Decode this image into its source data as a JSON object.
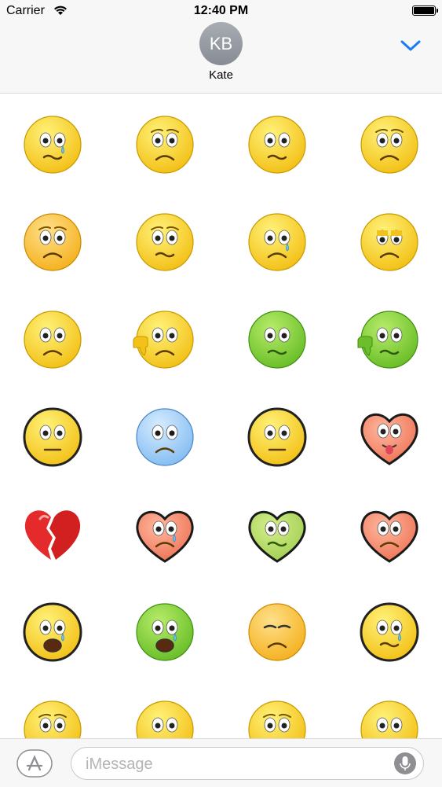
{
  "status_bar": {
    "carrier": "Carrier",
    "time": "12:40 PM"
  },
  "header": {
    "avatar_initials": "KB",
    "contact_name": "Kate"
  },
  "input_bar": {
    "placeholder": "iMessage"
  },
  "icons": {
    "wifi": "wifi-icon",
    "battery": "battery-icon",
    "collapse": "chevron-down-icon",
    "app_store": "app-store-icon",
    "microphone": "microphone-icon"
  },
  "colors": {
    "accent": "#1a7cf5",
    "bar_bg": "#f7f7f7",
    "avatar": "#9a9ea5"
  },
  "stickers": [
    {
      "name": "crying-face",
      "face": "yellow",
      "mouth": "wavy",
      "extra": "tear"
    },
    {
      "name": "worried-face",
      "face": "yellow",
      "mouth": "frown",
      "extra": "brows"
    },
    {
      "name": "confused-face",
      "face": "yellow",
      "mouth": "wavy",
      "extra": ""
    },
    {
      "name": "pleading-face",
      "face": "yellow",
      "mouth": "frown",
      "extra": "brows"
    },
    {
      "name": "sad-stare-face",
      "face": "orange",
      "mouth": "frown",
      "extra": "brows"
    },
    {
      "name": "anxious-face",
      "face": "yellow",
      "mouth": "wavy",
      "extra": "brows"
    },
    {
      "name": "tearful-face",
      "face": "yellow",
      "mouth": "frown",
      "extra": "tear"
    },
    {
      "name": "tired-face",
      "face": "yellow",
      "mouth": "frown",
      "extra": "droopy"
    },
    {
      "name": "frowning-face",
      "face": "yellow",
      "mouth": "frown",
      "extra": ""
    },
    {
      "name": "thumbs-down-yellow-face",
      "face": "yellow",
      "mouth": "frown",
      "extra": "thumbsdown"
    },
    {
      "name": "sick-green-face",
      "face": "green",
      "mouth": "wavy",
      "extra": ""
    },
    {
      "name": "thumbs-down-green-face",
      "face": "green",
      "mouth": "wavy",
      "extra": "thumbsdown"
    },
    {
      "name": "bulging-eyes-face",
      "face": "yellow",
      "mouth": "flat",
      "extra": ""
    },
    {
      "name": "blue-sad-face",
      "face": "blue",
      "mouth": "frown",
      "extra": ""
    },
    {
      "name": "eye-roll-face",
      "face": "yellow",
      "mouth": "flat",
      "extra": ""
    },
    {
      "name": "heart-tongue-face",
      "face": "heart-red",
      "mouth": "tongue",
      "extra": ""
    },
    {
      "name": "broken-heart",
      "face": "broken-heart",
      "mouth": "none",
      "extra": ""
    },
    {
      "name": "heart-crying-face",
      "face": "heart-red",
      "mouth": "frown",
      "extra": "tear"
    },
    {
      "name": "heart-sick-green-face",
      "face": "heart-green",
      "mouth": "wavy",
      "extra": ""
    },
    {
      "name": "heart-sad-face",
      "face": "heart-red",
      "mouth": "frown",
      "extra": ""
    },
    {
      "name": "wailing-face",
      "face": "yellow",
      "mouth": "open",
      "extra": "tear"
    },
    {
      "name": "melting-green-face",
      "face": "green",
      "mouth": "open",
      "extra": "tear"
    },
    {
      "name": "sleepy-tear-face",
      "face": "orange",
      "mouth": "frown",
      "extra": "closed"
    },
    {
      "name": "single-tear-face",
      "face": "yellow",
      "mouth": "wavy",
      "extra": "tear"
    },
    {
      "name": "partial-face-1",
      "face": "yellow",
      "mouth": "frown",
      "extra": "brows"
    },
    {
      "name": "partial-face-2",
      "face": "yellow",
      "mouth": "frown",
      "extra": ""
    },
    {
      "name": "partial-face-3",
      "face": "yellow",
      "mouth": "frown",
      "extra": "brows"
    },
    {
      "name": "partial-face-4",
      "face": "yellow",
      "mouth": "frown",
      "extra": ""
    }
  ]
}
